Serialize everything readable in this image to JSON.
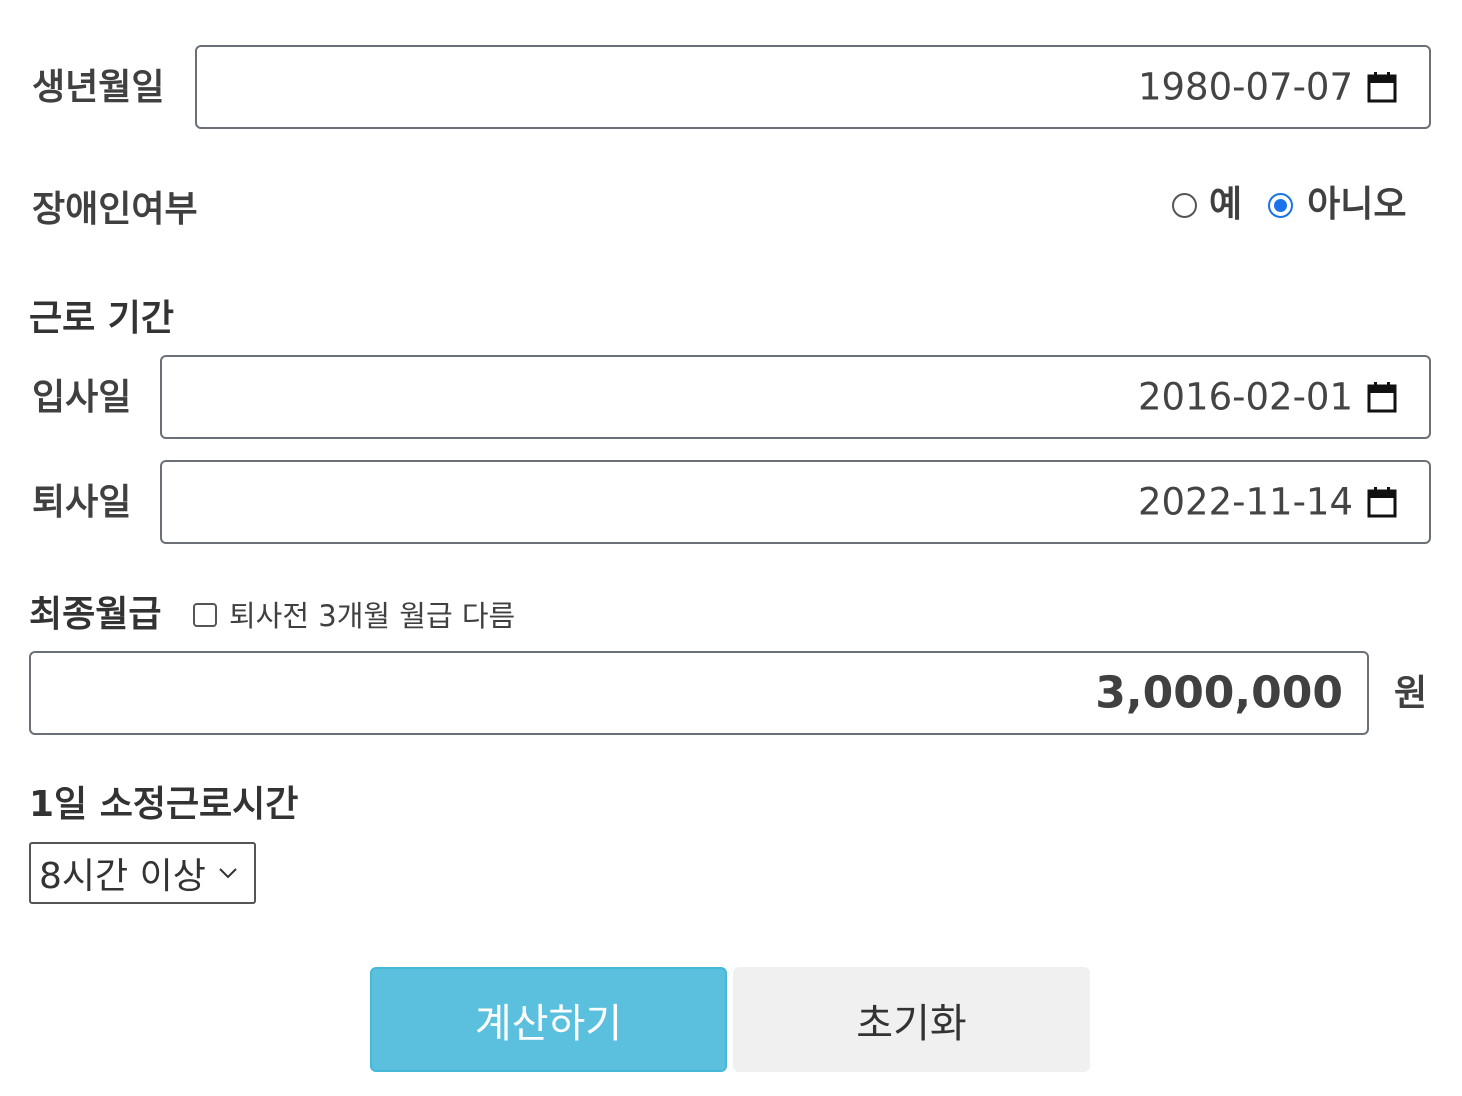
{
  "birth": {
    "label": "생년월일",
    "value": "1980-07-07"
  },
  "disabled": {
    "label": "장애인여부",
    "options": [
      {
        "label": "예",
        "checked": false
      },
      {
        "label": "아니오",
        "checked": true
      }
    ]
  },
  "work_period": {
    "title": "근로 기간",
    "start": {
      "label": "입사일",
      "value": "2016-02-01"
    },
    "end": {
      "label": "퇴사일",
      "value": "2022-11-14"
    }
  },
  "salary": {
    "label": "최종월급",
    "checkbox_label": "퇴사전 3개월 월급 다름",
    "checkbox_checked": false,
    "value": "3,000,000",
    "unit": "원"
  },
  "work_hours": {
    "title": "1일 소정근로시간",
    "selected": "8시간 이상"
  },
  "buttons": {
    "calculate": "계산하기",
    "reset": "초기화"
  },
  "colors": {
    "calculate_bg": "#5bc0de",
    "reset_bg": "#f0f0f0",
    "radio_accent": "#1a73e8"
  },
  "icons": {
    "date_picker": "calendar-icon",
    "select_arrow": "chevron-down-icon"
  }
}
